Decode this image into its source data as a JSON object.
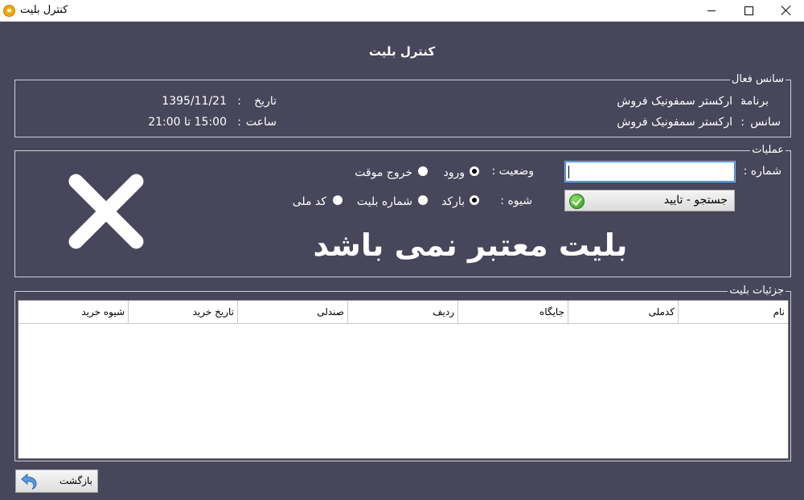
{
  "window": {
    "title": "کنترل بلیت",
    "icon": "app-ticket-icon",
    "controls": [
      "minimize-icon",
      "maximize-icon",
      "close-icon"
    ]
  },
  "heading": "کنترل بلیت",
  "active_session": {
    "legend": "سانس فعال",
    "program_label": "برنامه",
    "program_value": "ارکستر سمفونیک فروش",
    "session_label": "سانس",
    "session_value": "ارکستر سمفونیک فروش",
    "date_label": "تاریخ",
    "date_value": "1395/11/21",
    "time_label": "ساعت",
    "time_value": "15:00 تا 21:00",
    "colon": ":"
  },
  "operations": {
    "legend": "عملیات",
    "number_label": "شماره :",
    "number_value": "",
    "search_button": "جستجو - تایید",
    "status_label": "وضعیت :",
    "status_options": [
      "ورود",
      "خروج موقت"
    ],
    "status_selected": "ورود",
    "method_label": "شیوه :",
    "method_options": [
      "بارکد",
      "شماره بلیت",
      "کد ملی"
    ],
    "method_selected": "بارکد",
    "result_message": "بلیت معتبر نمی باشد",
    "result_icon": "invalid-x-icon"
  },
  "details": {
    "legend": "جزئیات بلیت",
    "columns": [
      "نام",
      "کدملی",
      "جایگاه",
      "ردیف",
      "صندلی",
      "تاریخ خرید",
      "شیوه خرید"
    ],
    "rows": []
  },
  "back_button": "بازگشت",
  "colors": {
    "background": "#47465a",
    "text": "#ffffff",
    "accent": "#3c7fd6"
  }
}
